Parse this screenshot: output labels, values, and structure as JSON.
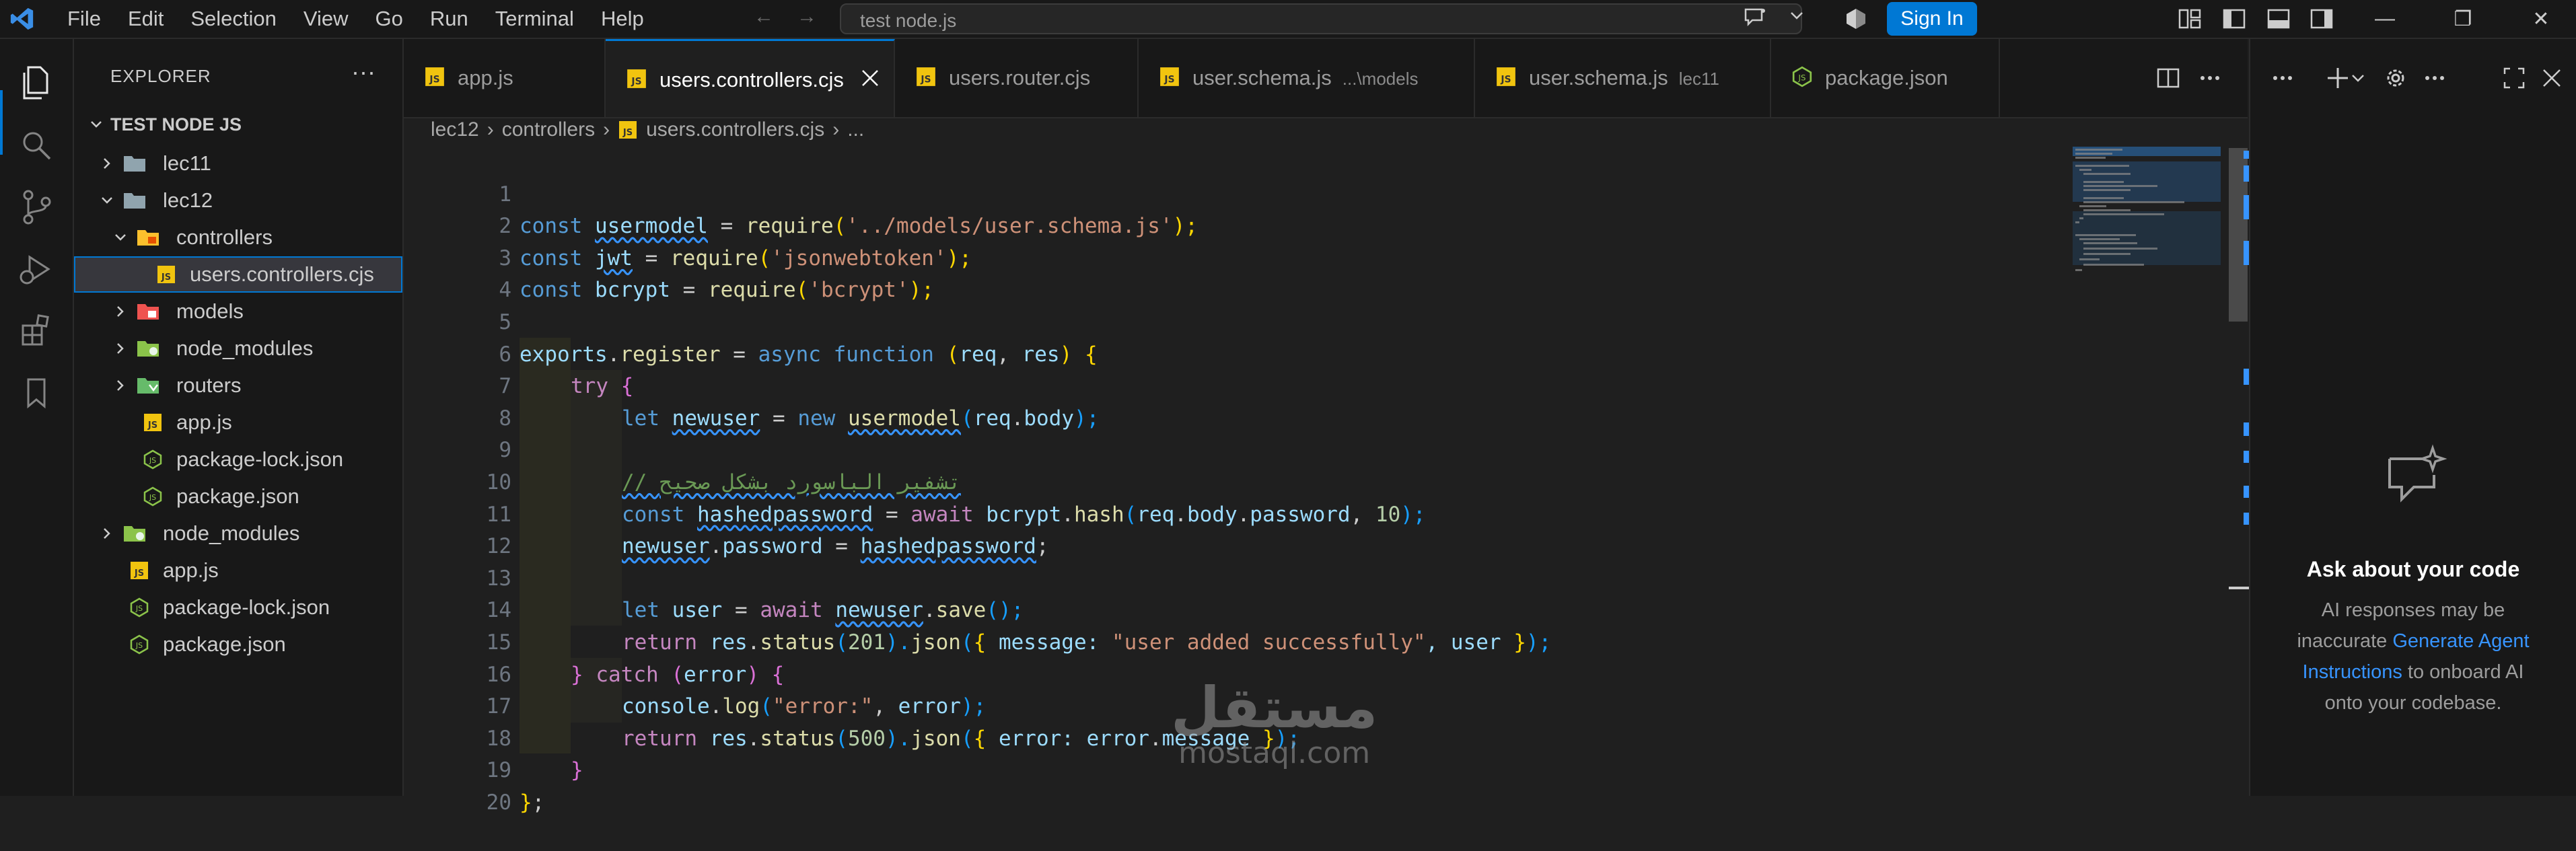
{
  "menu": [
    "File",
    "Edit",
    "Selection",
    "View",
    "Go",
    "Run",
    "Terminal",
    "Help"
  ],
  "search": {
    "text": "test node.js"
  },
  "titlebar": {
    "sign_in": "Sign In"
  },
  "window_controls": {
    "minimize": "—",
    "restore": "❐",
    "close": "✕"
  },
  "sidebar": {
    "title": "EXPLORER",
    "more": "···",
    "root": "TEST NODE JS",
    "items": [
      {
        "label": "lec11"
      },
      {
        "label": "lec12"
      },
      {
        "label": "controllers"
      },
      {
        "label": "users.controllers.cjs"
      },
      {
        "label": "models"
      },
      {
        "label": "node_modules"
      },
      {
        "label": "routers"
      },
      {
        "label": "app.js"
      },
      {
        "label": "package-lock.json"
      },
      {
        "label": "package.json"
      },
      {
        "label": "node_modules"
      },
      {
        "label": "app.js"
      },
      {
        "label": "package-lock.json"
      },
      {
        "label": "package.json"
      }
    ]
  },
  "tabs": [
    {
      "label": "app.js",
      "desc": ""
    },
    {
      "label": "users.controllers.cjs",
      "desc": ""
    },
    {
      "label": "users.router.cjs",
      "desc": ""
    },
    {
      "label": "user.schema.js",
      "desc": "...\\models"
    },
    {
      "label": "user.schema.js",
      "desc": "lec11"
    },
    {
      "label": "package.json",
      "desc": ""
    }
  ],
  "breadcrumb": [
    "lec12",
    "controllers",
    "users.controllers.cjs",
    "..."
  ],
  "line_numbers": [
    "1",
    "2",
    "3",
    "4",
    "5",
    "6",
    "7",
    "8",
    "9",
    "10",
    "11",
    "12",
    "13",
    "14",
    "15",
    "16",
    "17",
    "18",
    "19",
    "20"
  ],
  "code": {
    "l1": [
      "const",
      " ",
      "usermodel",
      " = ",
      "require",
      "(",
      "'../models/user.schema.js'",
      ");"
    ],
    "l2": [
      "const",
      " ",
      "jwt",
      " = ",
      "require",
      "(",
      "'jsonwebtoken'",
      ");"
    ],
    "l3": [
      "const",
      " ",
      "bcrypt",
      " = ",
      "require",
      "(",
      "'bcrypt'",
      ");"
    ],
    "l5": [
      "exports",
      ".",
      "register",
      " = ",
      "async",
      " ",
      "function",
      " (",
      "req",
      ", ",
      "res",
      ") ",
      "{"
    ],
    "l6": [
      "try",
      " ",
      "{"
    ],
    "l7": [
      "let",
      " ",
      "newuser",
      " = ",
      "new",
      " ",
      "usermodel",
      "(",
      "req",
      ".",
      "body",
      ");"
    ],
    "l9": [
      "// تشفير الباسورد بشكل صحيح"
    ],
    "l10": [
      "const",
      " ",
      "hashedpassword",
      " = ",
      "await",
      " ",
      "bcrypt",
      ".",
      "hash",
      "(",
      "req",
      ".",
      "body",
      ".",
      "password",
      ", ",
      "10",
      ");"
    ],
    "l11": [
      "newuser",
      ".",
      "password",
      " = ",
      "hashedpassword",
      ";"
    ],
    "l13": [
      "let",
      " ",
      "user",
      " = ",
      "await",
      " ",
      "newuser",
      ".",
      "save",
      "();"
    ],
    "l14": [
      "return",
      " ",
      "res",
      ".",
      "status",
      "(",
      "201",
      ").",
      "json",
      "(",
      "{",
      " message: ",
      "\"user added successfully\"",
      ", user ",
      "}",
      ");"
    ],
    "l15": [
      "}",
      " ",
      "catch",
      " (",
      "error",
      ") ",
      "{"
    ],
    "l16": [
      "console",
      ".",
      "log",
      "(",
      "\"error:\"",
      ", ",
      "error",
      ");"
    ],
    "l17": [
      "return",
      " ",
      "res",
      ".",
      "status",
      "(",
      "500",
      ").",
      "json",
      "(",
      "{",
      " error: ",
      "error",
      ".",
      "message",
      " ",
      "}",
      ");"
    ],
    "l18": [
      "}"
    ],
    "l19": [
      "}",
      ";"
    ]
  },
  "watermark": {
    "arabic": "مستقل",
    "latin": "mostaql.com"
  },
  "chat": {
    "title": "Ask about your code",
    "desc_1": "AI responses may be inaccurate",
    "link": "Generate Agent Instructions",
    "desc_2": " to onboard AI onto your codebase."
  },
  "colors": {
    "accent": "#0078d4",
    "link": "#3794ff",
    "js_icon": "#f1c40f",
    "json_icon": "#8bc34a"
  }
}
